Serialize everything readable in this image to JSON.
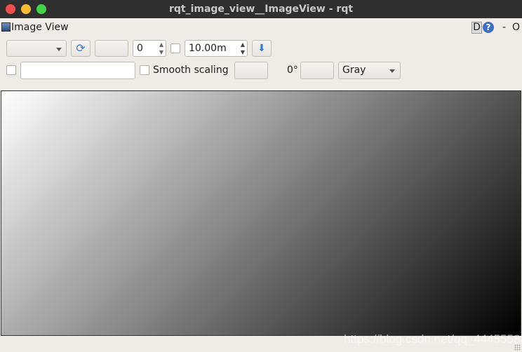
{
  "window": {
    "title": "rqt_image_view__ImageView - rqt"
  },
  "plugin": {
    "title": "Image View",
    "d_label": "D",
    "help_icon": "help-icon",
    "minimize_label": "-",
    "close_label": "O"
  },
  "toolbar": {
    "topic_value": "",
    "number_value": "0",
    "timeout_value": "10.00m",
    "smooth_scaling_label": "Smooth scaling",
    "rotation_label": "0°",
    "colormap_value": "Gray",
    "text_field_value": ""
  },
  "image": {
    "gradient": "white top-left to black bottom-right"
  },
  "watermark": "https://blog.csdn.net/qq_44455588"
}
